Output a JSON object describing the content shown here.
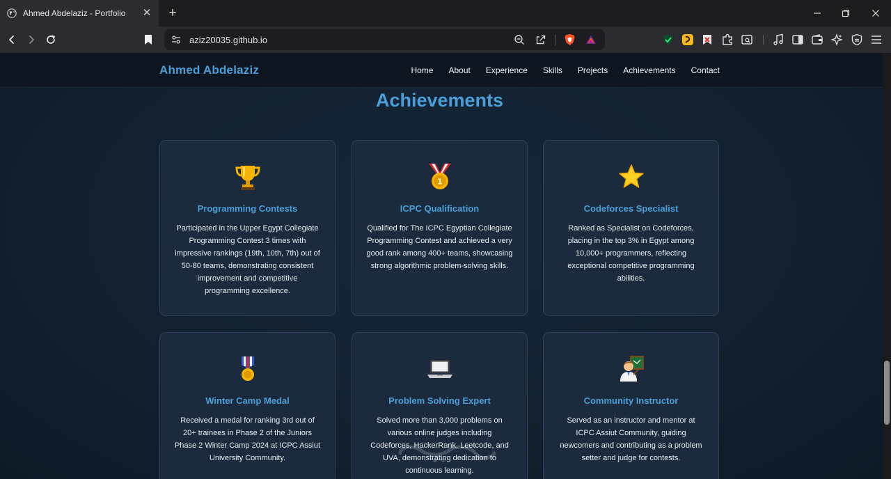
{
  "browser": {
    "tab_title": "Ahmed Abdelaziz - Portfolio",
    "url": "aziz20035.github.io"
  },
  "site": {
    "brand": "Ahmed Abdelaziz",
    "nav": [
      "Home",
      "About",
      "Experience",
      "Skills",
      "Projects",
      "Achievements",
      "Contact"
    ],
    "section_title": "Achievements"
  },
  "cards": [
    {
      "icon": "trophy-icon",
      "title": "Programming Contests",
      "desc": "Participated in the Upper Egypt Collegiate Programming Contest 3 times with impressive rankings (19th, 10th, 7th) out of 50-80 teams, demonstrating consistent improvement and competitive programming excellence."
    },
    {
      "icon": "medal-icon",
      "title": "ICPC Qualification",
      "desc": "Qualified for The ICPC Egyptian Collegiate Programming Contest and achieved a very good rank among 400+ teams, showcasing strong algorithmic problem-solving skills."
    },
    {
      "icon": "star-icon",
      "title": "Codeforces Specialist",
      "desc": "Ranked as Specialist on Codeforces, placing in the top 3% in Egypt among 10,000+ programmers, reflecting exceptional competitive programming abilities."
    },
    {
      "icon": "military-medal-icon",
      "title": "Winter Camp Medal",
      "desc": "Received a medal for ranking 3rd out of 20+ trainees in Phase 2 of the Juniors Phase 2 Winter Camp 2024 at ICPC Assiut University Community."
    },
    {
      "icon": "laptop-icon",
      "title": "Problem Solving Expert",
      "desc": "Solved more than 3,000 problems on various online judges including Codeforces, HackerRank, Leetcode, and UVA, demonstrating dedication to continuous learning."
    },
    {
      "icon": "teacher-icon",
      "title": "Community Instructor",
      "desc": "Served as an instructor and mentor at ICPC Assiut Community, guiding newcomers and contributing as a problem setter and judge for contests."
    }
  ]
}
